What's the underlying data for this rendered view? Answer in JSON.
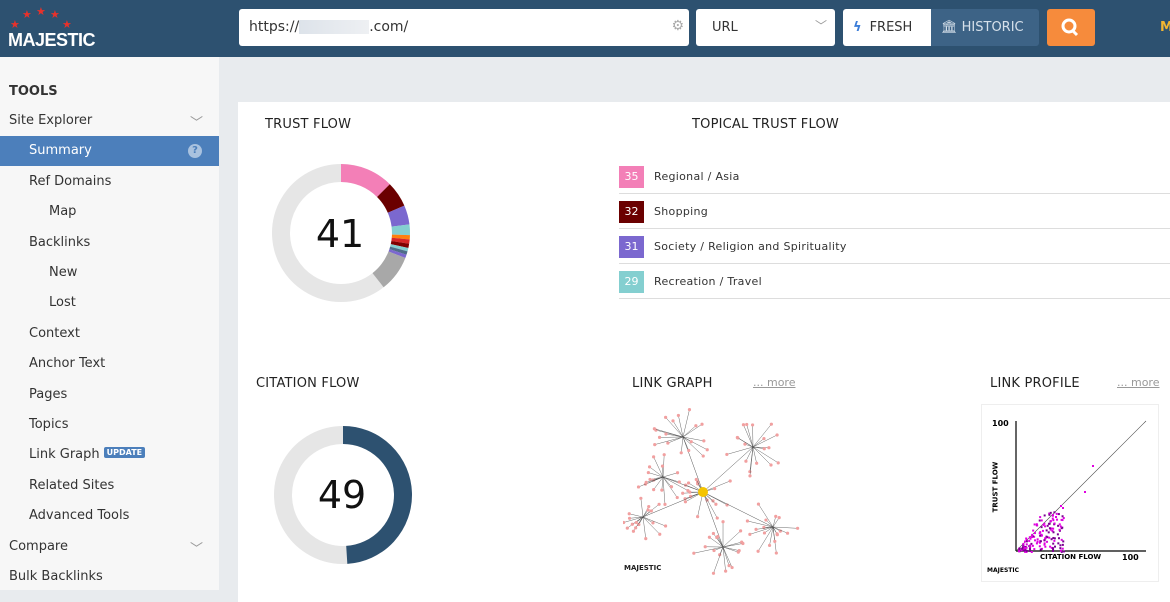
{
  "header": {
    "logo": "MAJESTIC",
    "url_prefix": "https://",
    "url_suffix": ".com/",
    "search_type": "URL",
    "fresh": "FRESH",
    "historic": "HISTORIC",
    "user_initial": "M"
  },
  "sidebar": {
    "heading": "TOOLS",
    "items": [
      {
        "label": "Site Explorer",
        "level": 0,
        "expand": true
      },
      {
        "label": "Summary",
        "level": 1,
        "active": true,
        "help": "?"
      },
      {
        "label": "Ref Domains",
        "level": 1
      },
      {
        "label": "Map",
        "level": 2
      },
      {
        "label": "Backlinks",
        "level": 1
      },
      {
        "label": "New",
        "level": 2
      },
      {
        "label": "Lost",
        "level": 2
      },
      {
        "label": "Context",
        "level": 1
      },
      {
        "label": "Anchor Text",
        "level": 1
      },
      {
        "label": "Pages",
        "level": 1
      },
      {
        "label": "Topics",
        "level": 1
      },
      {
        "label": "Link Graph",
        "level": 1,
        "badge": "UPDATE"
      },
      {
        "label": "Related Sites",
        "level": 1
      },
      {
        "label": "Advanced Tools",
        "level": 1
      },
      {
        "label": "Compare",
        "level": 0,
        "expand": true
      },
      {
        "label": "Bulk Backlinks",
        "level": 0
      }
    ]
  },
  "trust_flow": {
    "title": "TRUST FLOW",
    "value": "41",
    "segments": [
      {
        "color": "#f37fb7",
        "fraction": 0.125
      },
      {
        "color": "#6b0000",
        "fraction": 0.06
      },
      {
        "color": "#7b68cf",
        "fraction": 0.045
      },
      {
        "color": "#84cfd0",
        "fraction": 0.025
      },
      {
        "color": "#ff7f0e",
        "fraction": 0.01
      },
      {
        "color": "#d62728",
        "fraction": 0.01
      },
      {
        "color": "#800000",
        "fraction": 0.01
      },
      {
        "color": "#84cfd0",
        "fraction": 0.008
      },
      {
        "color": "#4f6d8a",
        "fraction": 0.008
      },
      {
        "color": "#7b68cf",
        "fraction": 0.008
      },
      {
        "color": "#a8a8a8",
        "fraction": 0.085
      }
    ]
  },
  "topical": {
    "title": "TOPICAL TRUST FLOW",
    "items": [
      {
        "value": "35",
        "label": "Regional / Asia",
        "color": "#f37fb7"
      },
      {
        "value": "32",
        "label": "Shopping",
        "color": "#6b0000"
      },
      {
        "value": "31",
        "label": "Society / Religion and Spirituality",
        "color": "#7b68cf"
      },
      {
        "value": "29",
        "label": "Recreation / Travel",
        "color": "#84cfd0"
      }
    ]
  },
  "citation_flow": {
    "title": "CITATION FLOW",
    "value": "49",
    "color": "#2d5170",
    "fraction": 0.49
  },
  "link_graph": {
    "title": "LINK GRAPH",
    "more": "... more",
    "watermark": "MAJESTIC"
  },
  "link_profile": {
    "title": "LINK PROFILE",
    "more": "... more",
    "y_label": "TRUST FLOW",
    "x_label": "CITATION FLOW",
    "y_max": "100",
    "x_max": "100",
    "watermark": "MAJESTIC"
  }
}
